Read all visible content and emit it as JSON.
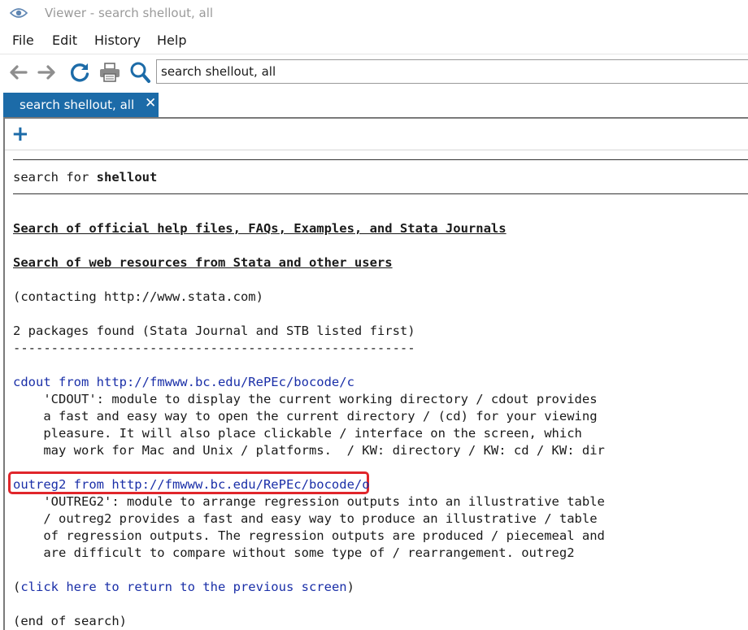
{
  "window": {
    "title": "Viewer - search shellout, all"
  },
  "menu": {
    "file": "File",
    "edit": "Edit",
    "history": "History",
    "help": "Help"
  },
  "toolbar": {
    "search_value": "search shellout, all"
  },
  "tabs": [
    {
      "label": "search shellout, all",
      "close": "✕"
    }
  ],
  "content": {
    "search_for_prefix": "search for ",
    "search_term": "shellout",
    "heading_official": "Search of official help files, FAQs, Examples, and Stata Journals",
    "heading_web": "Search of web resources from Stata and other users",
    "contacting": "(contacting http://www.stata.com)",
    "packages_found": "2 packages found (Stata Journal and STB listed first)",
    "dashes": "-----------------------------------------------------",
    "packages": [
      {
        "link": "cdout from http://fmwww.bc.edu/RePEc/bocode/c",
        "desc": [
          "    'CDOUT': module to display the current working directory / cdout provides",
          "    a fast and easy way to open the current directory / (cd) for your viewing",
          "    pleasure. It will also place clickable / interface on the screen, which",
          "    may work for Mac and Unix / platforms.  / KW: directory / KW: cd / KW: dir"
        ]
      },
      {
        "link": "outreg2 from http://fmwww.bc.edu/RePEc/bocode/o",
        "desc": [
          "    'OUTREG2': module to arrange regression outputs into an illustrative table",
          "    / outreg2 provides a fast and easy way to produce an illustrative / table",
          "    of regression outputs. The regression outputs are produced / piecemeal and",
          "    are difficult to compare without some type of / rearrangement. outreg2"
        ]
      }
    ],
    "return_open": "(",
    "return_link": "click here to return to the previous screen",
    "return_close": ")",
    "end": "(end of search)"
  },
  "colors": {
    "accent": "#1c6ba8",
    "link": "#1a2fa8",
    "highlight": "#e0262b"
  }
}
